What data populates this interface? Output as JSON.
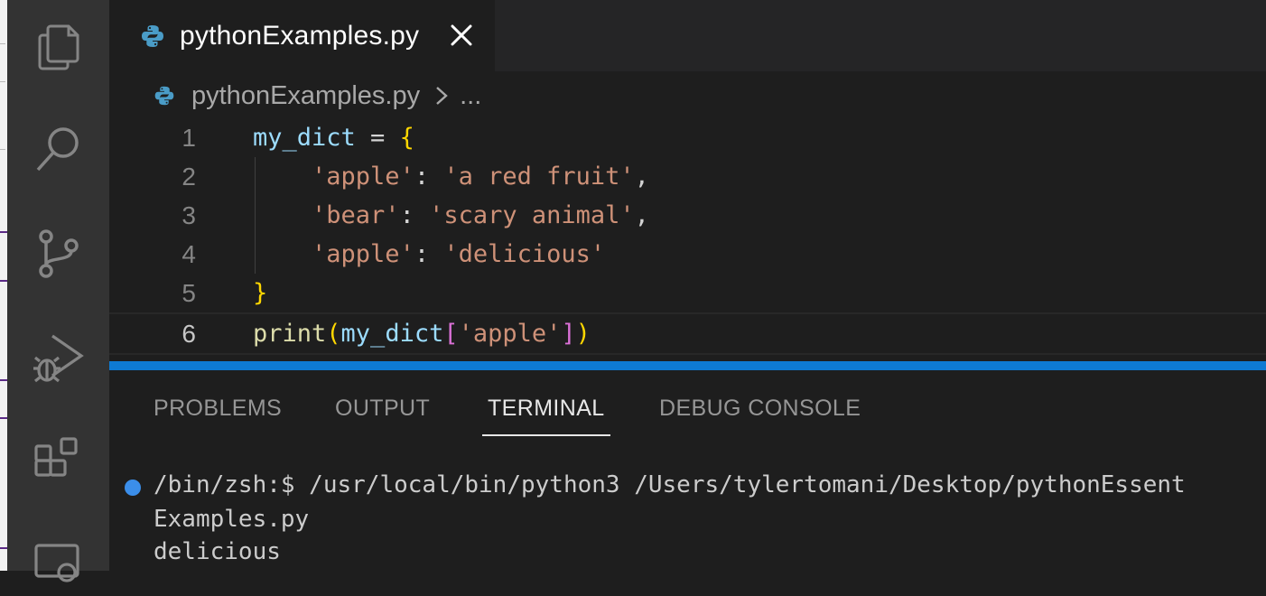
{
  "tab": {
    "filename": "pythonExamples.py"
  },
  "breadcrumb": {
    "file": "pythonExamples.py",
    "more": "..."
  },
  "editor": {
    "lines": [
      {
        "number": "1",
        "tokens": [
          [
            "var",
            "my_dict"
          ],
          [
            "op",
            " = "
          ],
          [
            "br1",
            "{"
          ]
        ]
      },
      {
        "number": "2",
        "tokens": [
          [
            "op",
            "    "
          ],
          [
            "str",
            "'apple'"
          ],
          [
            "op",
            ": "
          ],
          [
            "str",
            "'a red fruit'"
          ],
          [
            "op",
            ","
          ]
        ]
      },
      {
        "number": "3",
        "tokens": [
          [
            "op",
            "    "
          ],
          [
            "str",
            "'bear'"
          ],
          [
            "op",
            ": "
          ],
          [
            "str",
            "'scary animal'"
          ],
          [
            "op",
            ","
          ]
        ]
      },
      {
        "number": "4",
        "tokens": [
          [
            "op",
            "    "
          ],
          [
            "str",
            "'apple'"
          ],
          [
            "op",
            ": "
          ],
          [
            "str",
            "'delicious'"
          ]
        ]
      },
      {
        "number": "5",
        "tokens": [
          [
            "br1",
            "}"
          ]
        ]
      },
      {
        "number": "6",
        "tokens": [
          [
            "fn",
            "print"
          ],
          [
            "br1",
            "("
          ],
          [
            "var",
            "my_dict"
          ],
          [
            "br2",
            "["
          ],
          [
            "str",
            "'apple'"
          ],
          [
            "br2",
            "]"
          ],
          [
            "br1",
            ")"
          ]
        ]
      }
    ]
  },
  "panel": {
    "tabs": [
      "PROBLEMS",
      "OUTPUT",
      "TERMINAL",
      "DEBUG CONSOLE"
    ],
    "active_tab": "TERMINAL"
  },
  "terminal": {
    "lines": [
      "/bin/zsh:$ /usr/local/bin/python3 /Users/tylertomani/Desktop/pythonEssent",
      "Examples.py",
      "delicious"
    ]
  },
  "colors": {
    "accent": "#0e7ad3",
    "status_dot": "#3b8eea",
    "string": "#ce9178",
    "variable": "#9cdcfe",
    "function": "#dcdcaa",
    "bracket_gold": "#ffd700",
    "bracket_purple": "#da70d6"
  },
  "icons": {
    "activity_bar": [
      "explorer-icon",
      "search-icon",
      "source-control-icon",
      "run-debug-icon",
      "extensions-icon",
      "remote-explorer-icon"
    ],
    "tab": [
      "python-file-icon",
      "close-icon"
    ]
  }
}
